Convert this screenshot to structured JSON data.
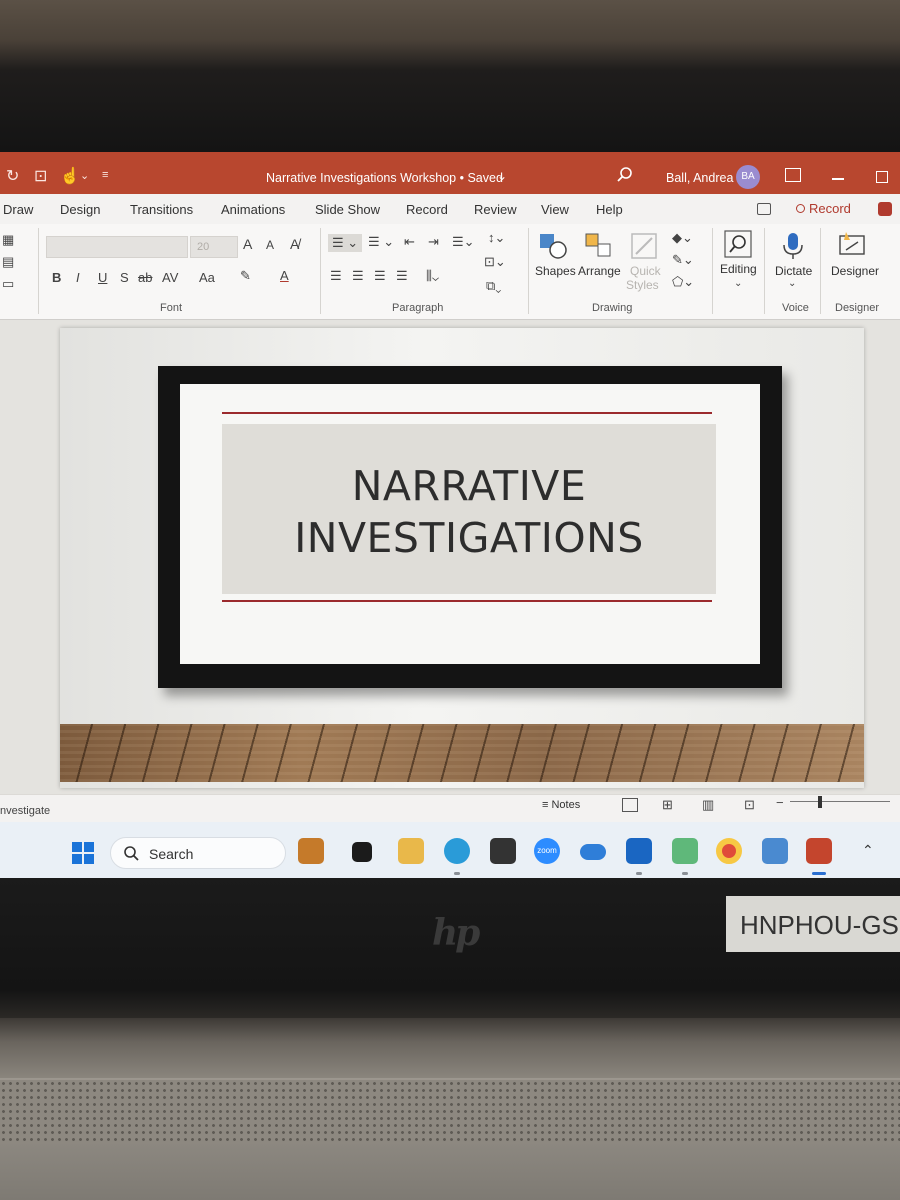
{
  "window": {
    "document_title": "Narrative Investigations Workshop • Saved",
    "user_name": "Ball, Andrea",
    "user_initials": "BA"
  },
  "ribbon_tabs": [
    "Draw",
    "Design",
    "Transitions",
    "Animations",
    "Slide Show",
    "Record",
    "Review",
    "View",
    "Help"
  ],
  "record_button": "Record",
  "ribbon": {
    "font_size": "20",
    "font_group": "Font",
    "paragraph_group": "Paragraph",
    "drawing_group": "Drawing",
    "voice_group": "Voice",
    "designer_group": "Designer",
    "shapes": "Shapes",
    "arrange": "Arrange",
    "quick_styles_1": "Quick",
    "quick_styles_2": "Styles",
    "editing": "Editing",
    "dictate": "Dictate",
    "designer": "Designer",
    "bold": "B",
    "italic": "I",
    "underline": "U",
    "shadow": "S",
    "strike": "ab",
    "spacing": "AV",
    "case": "Aa",
    "grow": "A",
    "shrink": "A"
  },
  "slide": {
    "title_line1": "NARRATIVE",
    "title_line2": "INVESTIGATIONS"
  },
  "statusbar": {
    "left_text": "nvestigate",
    "notes": "Notes"
  },
  "taskbar": {
    "search_label": "Search",
    "zoom_label": "zoom"
  },
  "hardware": {
    "asset_tag": "HNPHOU-GS"
  },
  "colors": {
    "titlebar": "#b8472f",
    "accent_red": "#9b2a2d",
    "record": "#b03a2e"
  }
}
